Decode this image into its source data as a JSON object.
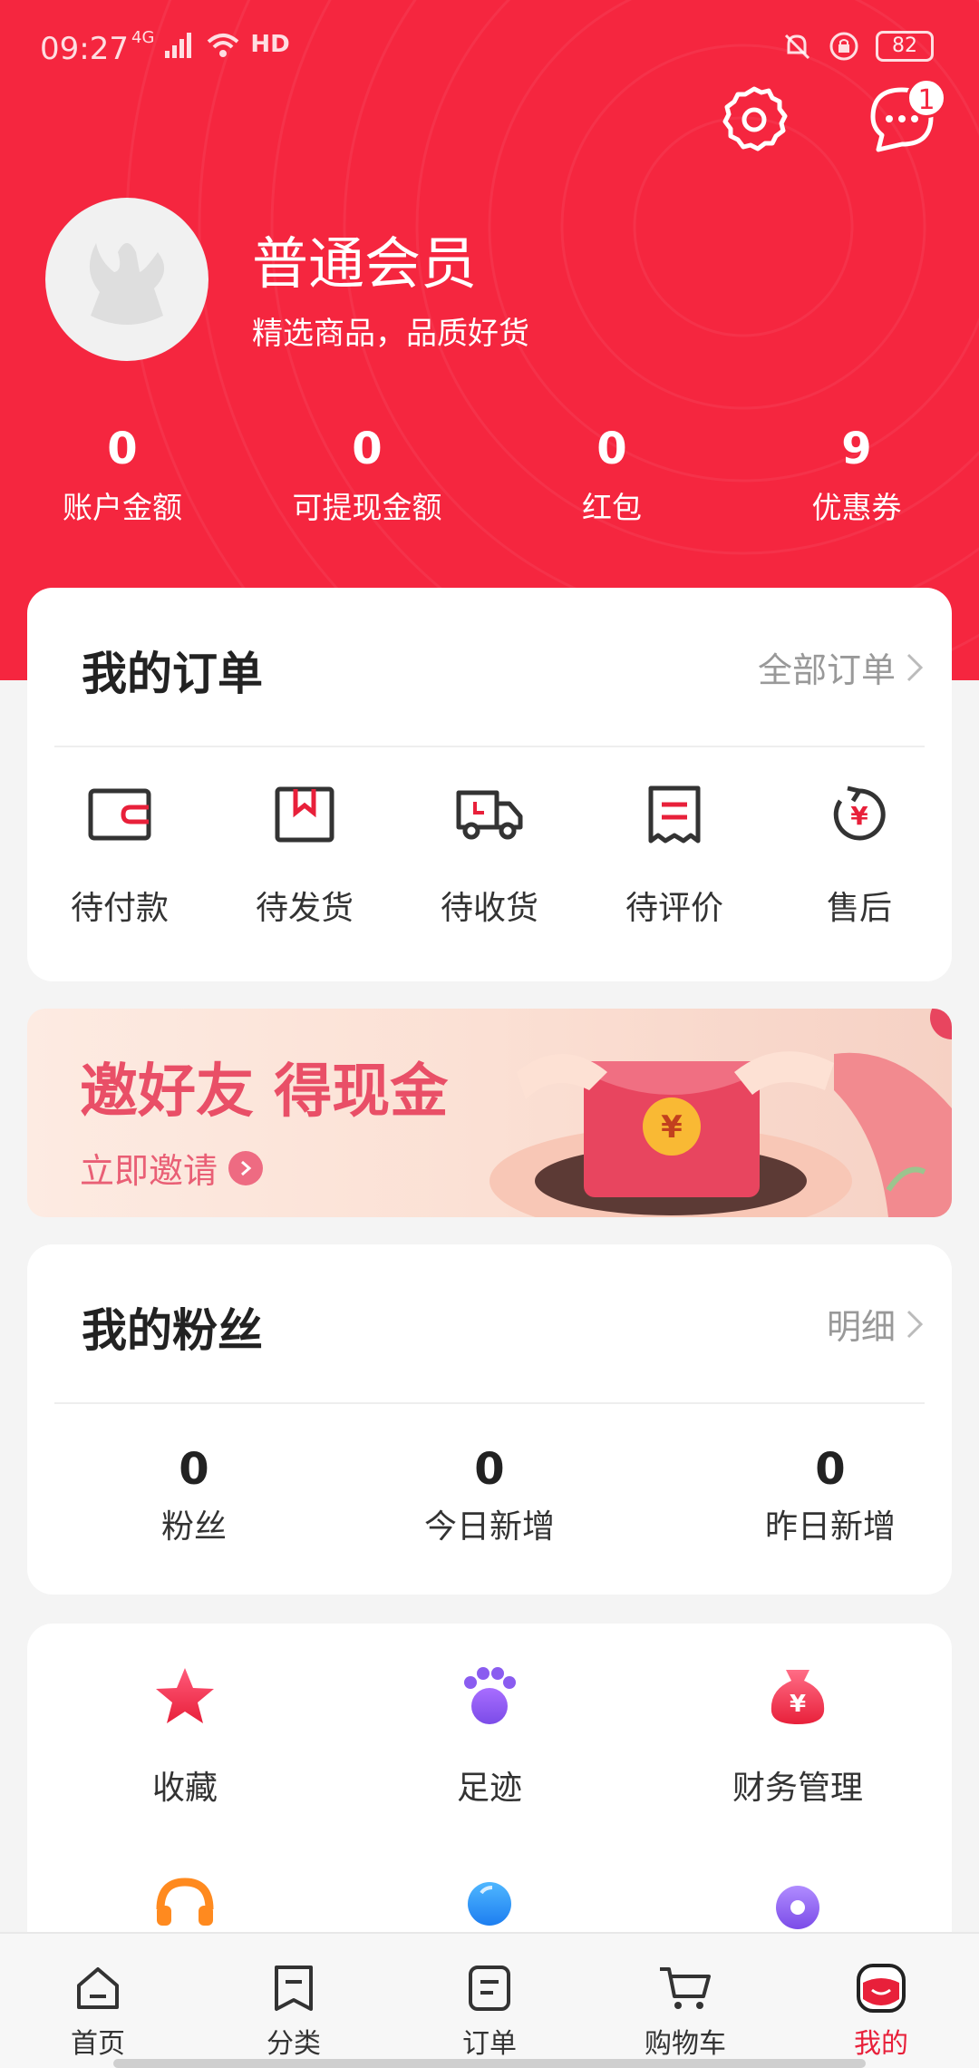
{
  "status_bar": {
    "time": "09:27",
    "network": "4G",
    "hd": "HD",
    "battery": "82"
  },
  "colors": {
    "brand_red": "#f5263f",
    "active_tab": "#e8203a",
    "banner_text": "#e94f67"
  },
  "header": {
    "member_title": "普通会员",
    "member_subtitle": "精选商品，品质好货",
    "message_badge": "1",
    "icons": [
      "gear-icon",
      "message-icon"
    ]
  },
  "stats": [
    {
      "value": "0",
      "label": "账户金额"
    },
    {
      "value": "0",
      "label": "可提现金额"
    },
    {
      "value": "0",
      "label": "红包"
    },
    {
      "value": "9",
      "label": "优惠券"
    }
  ],
  "orders": {
    "title": "我的订单",
    "link": "全部订单",
    "items": [
      {
        "label": "待付款",
        "icon": "wallet-icon"
      },
      {
        "label": "待发货",
        "icon": "box-icon"
      },
      {
        "label": "待收货",
        "icon": "truck-icon"
      },
      {
        "label": "待评价",
        "icon": "receipt-icon"
      },
      {
        "label": "售后",
        "icon": "refund-icon"
      }
    ]
  },
  "banner": {
    "title": "邀好友 得现金",
    "cta": "立即邀请"
  },
  "fans": {
    "title": "我的粉丝",
    "link": "明细",
    "items": [
      {
        "value": "0",
        "label": "粉丝"
      },
      {
        "value": "0",
        "label": "今日新增"
      },
      {
        "value": "0",
        "label": "昨日新增"
      }
    ]
  },
  "tools": [
    {
      "label": "收藏",
      "icon": "star-icon"
    },
    {
      "label": "足迹",
      "icon": "paw-icon"
    },
    {
      "label": "财务管理",
      "icon": "money-bag-icon"
    }
  ],
  "tabbar": [
    {
      "label": "首页",
      "icon": "home-icon"
    },
    {
      "label": "分类",
      "icon": "category-icon"
    },
    {
      "label": "订单",
      "icon": "order-icon"
    },
    {
      "label": "购物车",
      "icon": "cart-icon"
    },
    {
      "label": "我的",
      "icon": "profile-icon",
      "active": true
    }
  ]
}
